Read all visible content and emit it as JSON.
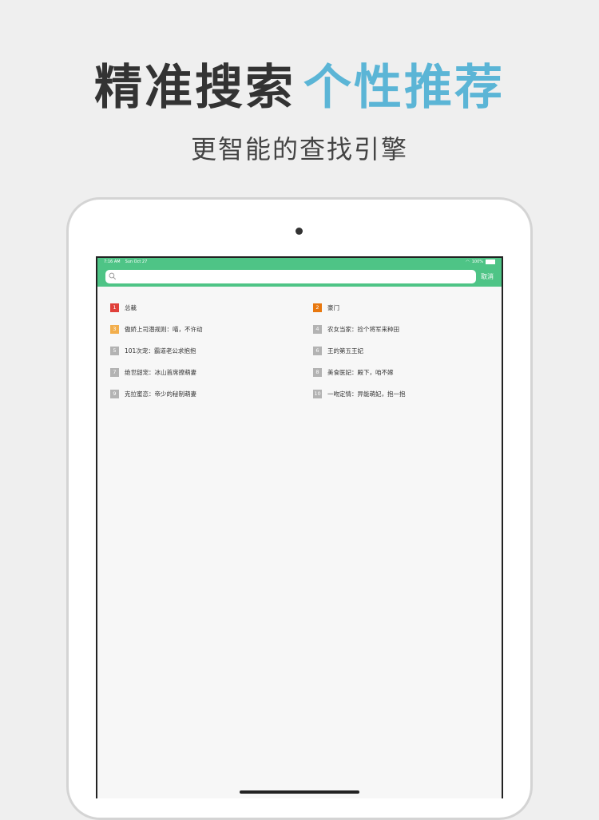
{
  "headline": {
    "dark": "精准搜索",
    "accent": "个性推荐"
  },
  "subheadline": "更智能的查找引擎",
  "colors": {
    "accent": "#5bb5d6",
    "app_green": "#4ec486",
    "rank1": "#e0403a",
    "rank2": "#e8780f",
    "rank3": "#f2ae4c",
    "rank_default": "#b3b3b3"
  },
  "status_bar": {
    "time": "7:16 AM",
    "date": "Sun Oct 27",
    "battery": "100%"
  },
  "search": {
    "placeholder": "",
    "value": "",
    "cancel_label": "取消",
    "icon": "search-icon"
  },
  "hot_list": [
    {
      "rank": "1",
      "title": "总裁"
    },
    {
      "rank": "2",
      "title": "豪门"
    },
    {
      "rank": "3",
      "title": "傲娇上司潜规则：喵，不许动"
    },
    {
      "rank": "4",
      "title": "农女当家：捡个将军来种田"
    },
    {
      "rank": "5",
      "title": "101次宠：霸道老公求抱抱"
    },
    {
      "rank": "6",
      "title": "王的第五王妃"
    },
    {
      "rank": "7",
      "title": "绝世甜宠：冰山首席撩萌妻"
    },
    {
      "rank": "8",
      "title": "美食医妃：殿下，咱不嫁"
    },
    {
      "rank": "9",
      "title": "克拉蜜恋：帝少的秘制萌妻"
    },
    {
      "rank": "10",
      "title": "一吻定情：异能萌妃，抱一抱"
    }
  ]
}
